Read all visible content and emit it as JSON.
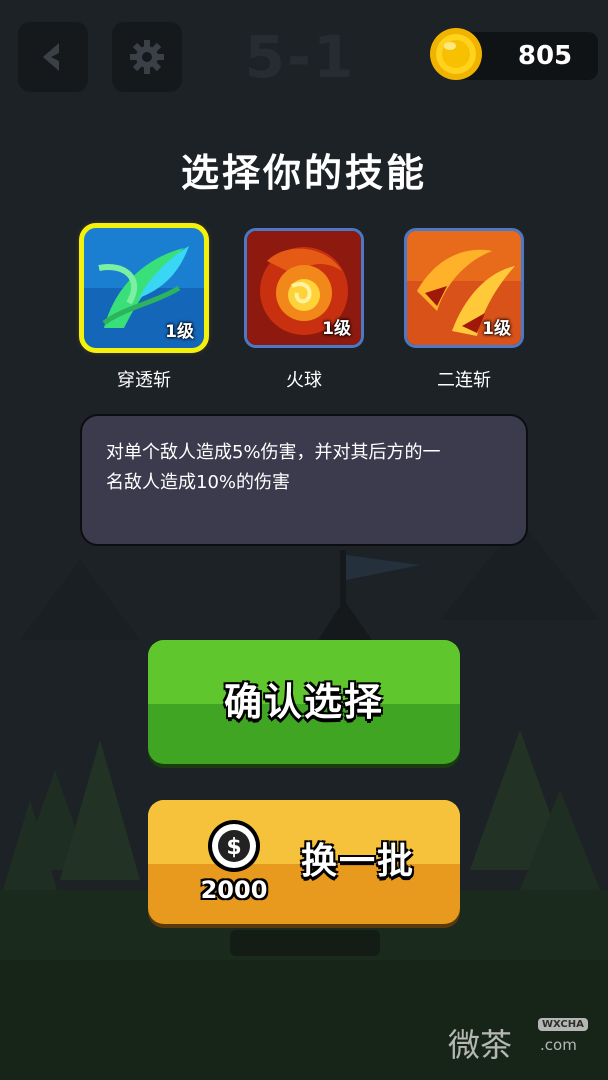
{
  "header": {
    "level": "5-1",
    "coins": "805",
    "back_icon": "back-arrow-icon",
    "settings_icon": "gear-icon",
    "coin_icon": "gold-coin-icon"
  },
  "title": "选择你的技能",
  "skills": [
    {
      "name": "穿透斩",
      "level": "1级",
      "selected": true,
      "icon": "piercing-slash-icon",
      "color": "#37c7f0"
    },
    {
      "name": "火球",
      "level": "1级",
      "selected": false,
      "icon": "fireball-icon",
      "color": "#e6451a"
    },
    {
      "name": "二连斩",
      "level": "1级",
      "selected": false,
      "icon": "double-slash-icon",
      "color": "#f07a1a"
    }
  ],
  "description": {
    "line1": "对单个敌人造成5%伤害，并对其后方的一",
    "line2": "名敌人造成10%的伤害"
  },
  "buttons": {
    "confirm_label": "确认选择",
    "refresh_label": "换一批",
    "refresh_cost": "2000",
    "cost_icon": "dollar-coin-icon"
  },
  "watermark": {
    "text": "微茶",
    "tag": "WXCHA",
    "domain": ".com"
  },
  "colors": {
    "selected_outline": "#f4f20c",
    "confirm_green": "#5fc62d",
    "refresh_orange": "#f7c23b",
    "panel": "#3c3a4d"
  }
}
